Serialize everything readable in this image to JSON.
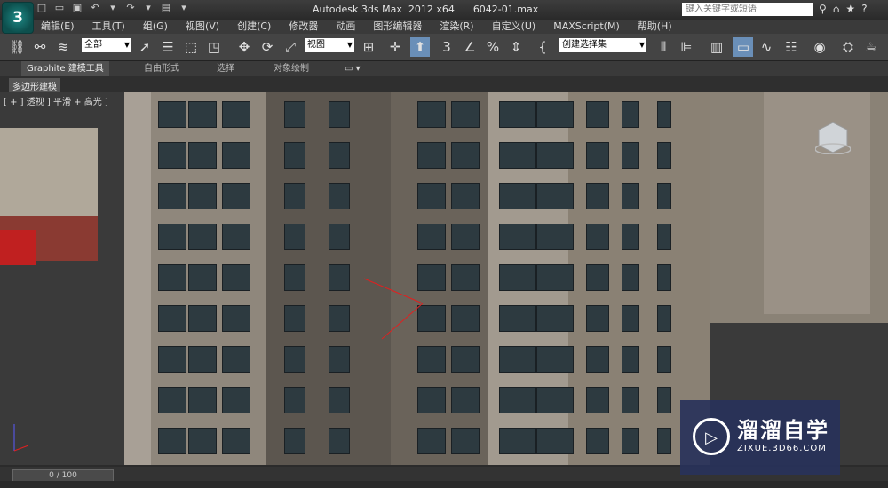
{
  "app": {
    "logo": "3",
    "window_title": "Autodesk 3ds Max  2012 x64",
    "file_name": "6042-01.max",
    "search_placeholder": "键入关键字或短语"
  },
  "menu": [
    "编辑(E)",
    "工具(T)",
    "组(G)",
    "视图(V)",
    "创建(C)",
    "修改器",
    "动画",
    "图形编辑器",
    "渲染(R)",
    "自定义(U)",
    "MAXScript(M)",
    "帮助(H)"
  ],
  "toolbar": {
    "selection_filter": "全部",
    "ref_coord": "视图",
    "named_selection": "创建选择集",
    "snap_3": "3",
    "snap_percent": "%"
  },
  "ribbon": {
    "tabs": [
      "Graphite 建模工具",
      "自由形式",
      "选择",
      "对象绘制"
    ],
    "subpanel": "多边形建模"
  },
  "viewport": {
    "label": "[ + ] 透视 ] 平滑 + 高光 ]"
  },
  "timeline": {
    "frame": "0 / 100"
  },
  "watermark": {
    "name": "溜溜自学",
    "url": "ZIXUE.3D66.COM"
  },
  "colors": {
    "accent": "#1e8a86",
    "viewport_bg": "#3a3a3a",
    "watermark_bg": "#283260"
  }
}
